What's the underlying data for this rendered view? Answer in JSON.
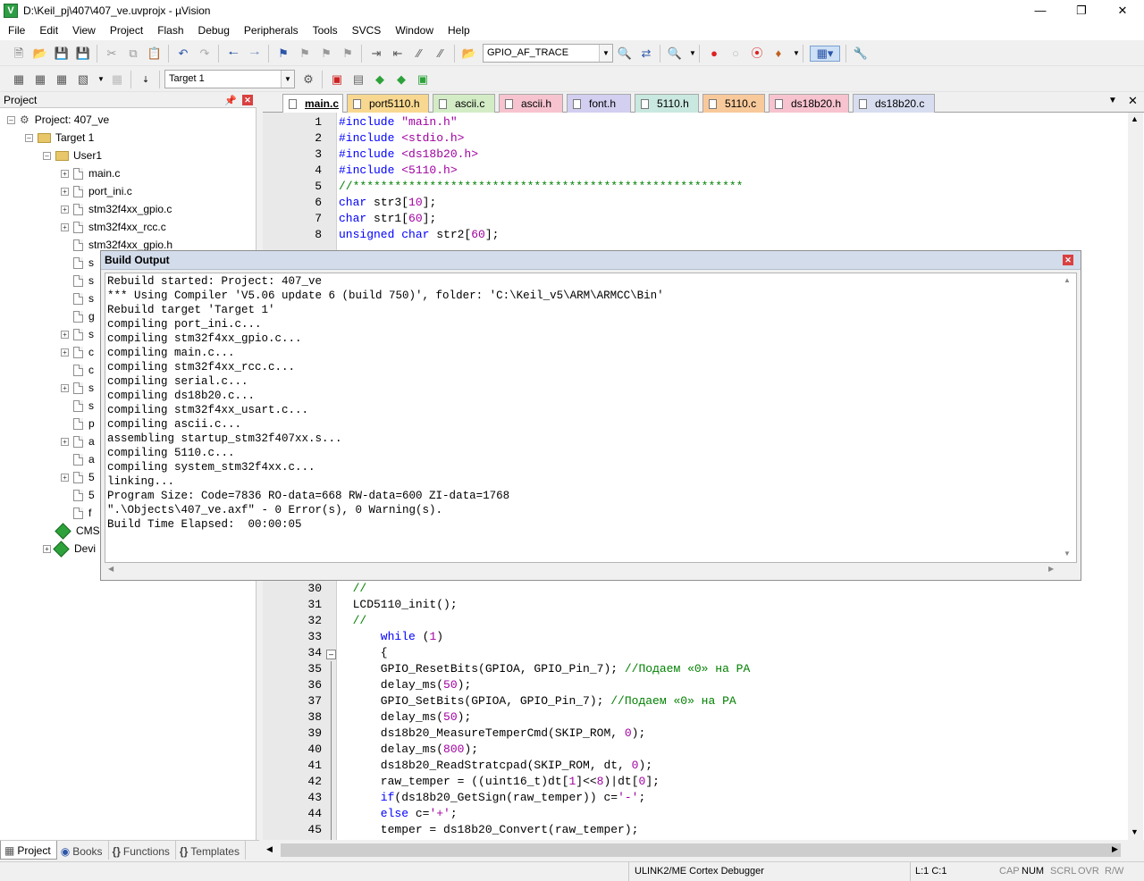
{
  "window": {
    "title": "D:\\Keil_pj\\407\\407_ve.uvprojx - µVision",
    "app_icon": "V"
  },
  "menu": [
    "File",
    "Edit",
    "View",
    "Project",
    "Flash",
    "Debug",
    "Peripherals",
    "Tools",
    "SVCS",
    "Window",
    "Help"
  ],
  "toolbar": {
    "search_combo": "GPIO_AF_TRACE",
    "target_combo": "Target 1"
  },
  "project_panel": {
    "title": "Project",
    "root": "Project: 407_ve",
    "target": "Target 1",
    "group": "User1",
    "files": [
      "main.c",
      "port_ini.c",
      "stm32f4xx_gpio.c",
      "stm32f4xx_rcc.c",
      "stm32f4xx_gpio.h"
    ],
    "partial_items": [
      "s",
      "s",
      "s",
      "g",
      "s",
      "c",
      "c",
      "s",
      "s",
      "p",
      "a",
      "a",
      "5",
      "5",
      "f"
    ],
    "cmsis": "CMS",
    "device": "Devi",
    "tabs": [
      "Project",
      "Books",
      "Functions",
      "Templates"
    ]
  },
  "editor": {
    "tabs": [
      "main.c",
      "port5110.h",
      "ascii.c",
      "ascii.h",
      "font.h",
      "5110.h",
      "5110.c",
      "ds18b20.h",
      "ds18b20.c"
    ],
    "lines_top": [
      {
        "n": "1",
        "segs": [
          [
            "kw",
            "#include "
          ],
          [
            "st",
            "\"main.h\""
          ]
        ]
      },
      {
        "n": "2",
        "segs": [
          [
            "kw",
            "#include "
          ],
          [
            "st",
            "<stdio.h>"
          ]
        ]
      },
      {
        "n": "3",
        "segs": [
          [
            "kw",
            "#include "
          ],
          [
            "st",
            "<ds18b20.h>"
          ]
        ]
      },
      {
        "n": "4",
        "segs": [
          [
            "kw",
            "#include "
          ],
          [
            "st",
            "<5110.h>"
          ]
        ]
      },
      {
        "n": "5",
        "segs": [
          [
            "cm",
            "//********************************************************"
          ]
        ]
      },
      {
        "n": "6",
        "segs": [
          [
            "kw",
            "char "
          ],
          [
            "",
            "str3["
          ],
          [
            "nm",
            "10"
          ],
          [
            "",
            "];"
          ]
        ]
      },
      {
        "n": "7",
        "segs": [
          [
            "kw",
            "char "
          ],
          [
            "",
            "str1["
          ],
          [
            "nm",
            "60"
          ],
          [
            "",
            "];"
          ]
        ]
      },
      {
        "n": "8",
        "segs": [
          [
            "kw",
            "unsigned char "
          ],
          [
            "",
            "str2["
          ],
          [
            "nm",
            "60"
          ],
          [
            "",
            "];"
          ]
        ]
      }
    ],
    "lines_bottom": [
      {
        "n": "30",
        "segs": [
          [
            "cm",
            "  //"
          ]
        ]
      },
      {
        "n": "31",
        "segs": [
          [
            "",
            "  LCD5110_init();"
          ]
        ]
      },
      {
        "n": "32",
        "segs": [
          [
            "cm",
            "  //"
          ]
        ]
      },
      {
        "n": "33",
        "segs": [
          [
            "kw",
            "      while "
          ],
          [
            "",
            "("
          ],
          [
            "nm",
            "1"
          ],
          [
            "",
            ")"
          ]
        ]
      },
      {
        "n": "34",
        "segs": [
          [
            "",
            "      {"
          ]
        ]
      },
      {
        "n": "35",
        "segs": [
          [
            "",
            "      GPIO_ResetBits(GPIOA, GPIO_Pin_7); "
          ],
          [
            "cm",
            "//Подаем «0» на PA"
          ]
        ]
      },
      {
        "n": "36",
        "segs": [
          [
            "",
            "      delay_ms("
          ],
          [
            "nm",
            "50"
          ],
          [
            "",
            ");"
          ]
        ]
      },
      {
        "n": "37",
        "segs": [
          [
            "",
            "      GPIO_SetBits(GPIOA, GPIO_Pin_7); "
          ],
          [
            "cm",
            "//Подаем «0» на PA"
          ]
        ]
      },
      {
        "n": "38",
        "segs": [
          [
            "",
            "      delay_ms("
          ],
          [
            "nm",
            "50"
          ],
          [
            "",
            ");"
          ]
        ]
      },
      {
        "n": "39",
        "segs": [
          [
            "",
            "      ds18b20_MeasureTemperCmd(SKIP_ROM, "
          ],
          [
            "nm",
            "0"
          ],
          [
            "",
            ");"
          ]
        ]
      },
      {
        "n": "40",
        "segs": [
          [
            "",
            "      delay_ms("
          ],
          [
            "nm",
            "800"
          ],
          [
            "",
            ");"
          ]
        ]
      },
      {
        "n": "41",
        "segs": [
          [
            "",
            "      ds18b20_ReadStratcpad(SKIP_ROM, dt, "
          ],
          [
            "nm",
            "0"
          ],
          [
            "",
            ");"
          ]
        ]
      },
      {
        "n": "42",
        "segs": [
          [
            "",
            "      raw_temper = ((uint16_t)dt["
          ],
          [
            "nm",
            "1"
          ],
          [
            "",
            "]<<"
          ],
          [
            "nm",
            "8"
          ],
          [
            "",
            ")|dt["
          ],
          [
            "nm",
            "0"
          ],
          [
            "",
            "];"
          ]
        ]
      },
      {
        "n": "43",
        "segs": [
          [
            "kw",
            "      if"
          ],
          [
            "",
            "(ds18b20_GetSign(raw_temper)) c="
          ],
          [
            "st",
            "'-'"
          ],
          [
            "",
            ";"
          ]
        ]
      },
      {
        "n": "44",
        "segs": [
          [
            "kw",
            "      else "
          ],
          [
            "",
            "c="
          ],
          [
            "st",
            "'+'"
          ],
          [
            "",
            ";"
          ]
        ]
      },
      {
        "n": "45",
        "segs": [
          [
            "",
            "      temper = ds18b20_Convert(raw_temper);"
          ]
        ]
      }
    ]
  },
  "build_output": {
    "title": "Build Output",
    "lines": [
      "Rebuild started: Project: 407_ve",
      "*** Using Compiler 'V5.06 update 6 (build 750)', folder: 'C:\\Keil_v5\\ARM\\ARMCC\\Bin'",
      "Rebuild target 'Target 1'",
      "compiling port_ini.c...",
      "compiling stm32f4xx_gpio.c...",
      "compiling main.c...",
      "compiling stm32f4xx_rcc.c...",
      "compiling serial.c...",
      "compiling ds18b20.c...",
      "compiling stm32f4xx_usart.c...",
      "compiling ascii.c...",
      "assembling startup_stm32f407xx.s...",
      "compiling 5110.c...",
      "compiling system_stm32f4xx.c...",
      "linking...",
      "Program Size: Code=7836 RO-data=668 RW-data=600 ZI-data=1768",
      "\".\\Objects\\407_ve.axf\" - 0 Error(s), 0 Warning(s).",
      "Build Time Elapsed:  00:00:05"
    ]
  },
  "status": {
    "debugger": "ULINK2/ME Cortex Debugger",
    "position": "L:1 C:1",
    "cap": "CAP",
    "num": "NUM",
    "scrl": "SCRL",
    "ovr": "OVR",
    "rw": "R/W"
  }
}
